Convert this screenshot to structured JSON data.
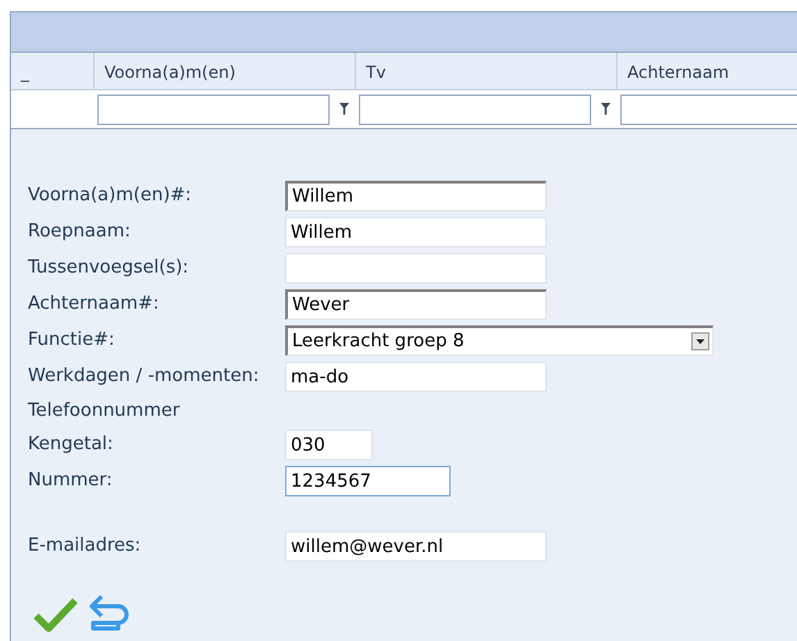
{
  "grid": {
    "columns": [
      {
        "label": "_"
      },
      {
        "label": "Voorna(a)m(en)",
        "filter": true
      },
      {
        "label": "Tv",
        "filter": true
      },
      {
        "label": "Achternaam",
        "filter": true
      }
    ]
  },
  "form": {
    "fields": [
      {
        "kind": "text",
        "label": "Voorna(a)m(en)#:",
        "value": "Willem",
        "required": true,
        "focused": false
      },
      {
        "kind": "text",
        "label": "Roepnaam:",
        "value": "Willem",
        "required": false,
        "focused": false
      },
      {
        "kind": "text",
        "label": "Tussenvoegsel(s):",
        "required": false,
        "focused": false
      },
      {
        "kind": "text",
        "label": "Achternaam#:",
        "value": "Wever",
        "required": true,
        "focused": false
      },
      {
        "kind": "select",
        "label": "Functie#:",
        "value": "Leerkracht groep 8",
        "required": true,
        "focused": false
      },
      {
        "kind": "text",
        "label": "Werkdagen / -momenten:",
        "value": "ma-do",
        "required": false,
        "focused": false
      },
      {
        "kind": "heading",
        "label": "Telefoonnummer"
      },
      {
        "kind": "text",
        "label": "Kengetal:",
        "value": "030",
        "required": false,
        "focused": false
      },
      {
        "kind": "text",
        "label": "Nummer:",
        "value": "1234567",
        "required": false,
        "focused": true
      },
      {
        "kind": "text",
        "label": "E-mailadres:",
        "value": "willem@wever.nl",
        "required": false,
        "focused": false,
        "gap_before": true
      }
    ]
  }
}
